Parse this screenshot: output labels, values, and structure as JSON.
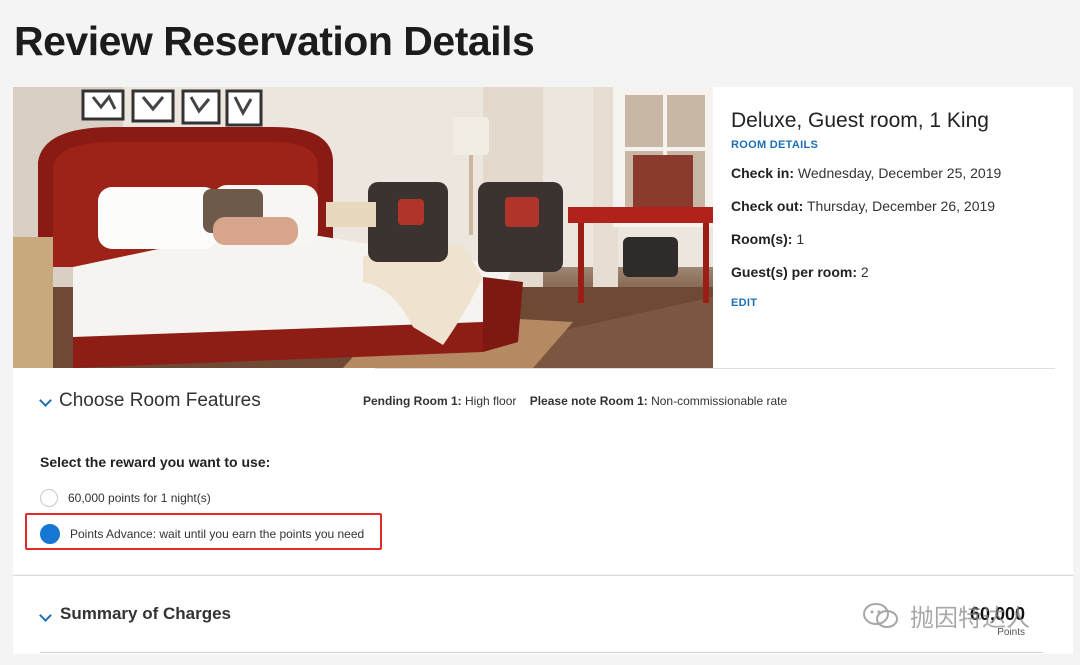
{
  "page": {
    "title": "Review Reservation Details"
  },
  "room": {
    "name": "Deluxe, Guest room, 1 King",
    "room_details_link": "ROOM DETAILS",
    "check_in_label": "Check in:",
    "check_in_value": "Wednesday, December 25, 2019",
    "check_out_label": "Check out:",
    "check_out_value": "Thursday, December 26, 2019",
    "rooms_label": "Room(s):",
    "rooms_value": "1",
    "guests_label": "Guest(s) per room:",
    "guests_value": "2",
    "edit_link": "EDIT"
  },
  "features": {
    "title": "Choose Room Features",
    "pending_label": "Pending Room 1:",
    "pending_value": "High floor",
    "note_label": "Please note Room 1:",
    "note_value": "Non-commissionable rate"
  },
  "reward": {
    "label": "Select the reward you want to use:",
    "options": [
      {
        "text": "60,000 points for 1 night(s)",
        "selected": false
      },
      {
        "text": "Points Advance: wait until you earn the points you need",
        "selected": true
      }
    ]
  },
  "summary": {
    "title": "Summary of Charges",
    "total": "60,000",
    "unit": "Points"
  },
  "watermark": {
    "text": "抛因特达人"
  },
  "colors": {
    "link": "#1c6fb5",
    "radio_selected": "#1477d3",
    "highlight": "#e12b2b"
  }
}
